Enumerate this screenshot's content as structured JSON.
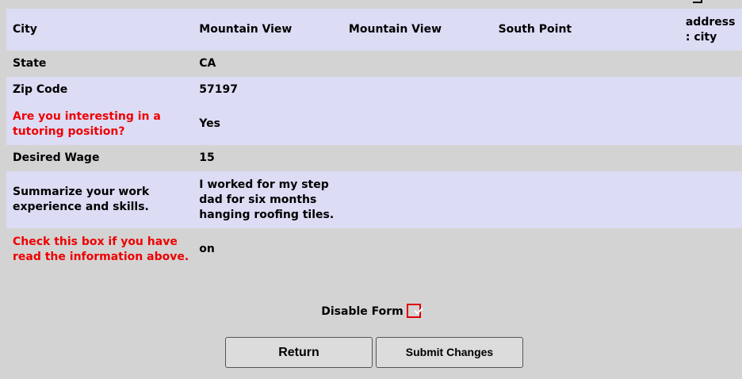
{
  "table": {
    "rows": [
      {
        "label": "City",
        "values": [
          "Mountain View",
          "Mountain View",
          "South Point",
          "address : city"
        ],
        "style": "alt",
        "label_color": "black"
      },
      {
        "label": "State",
        "values": [
          "CA",
          "",
          "",
          ""
        ],
        "style": "plain",
        "label_color": "black"
      },
      {
        "label": "Zip Code",
        "values": [
          "57197",
          "",
          "",
          ""
        ],
        "style": "alt",
        "label_color": "black"
      },
      {
        "label": "Are you interesting in a tutoring position?",
        "values": [
          "Yes",
          "",
          "",
          ""
        ],
        "style": "alt",
        "label_color": "red"
      },
      {
        "label": "Desired Wage",
        "values": [
          "15",
          "",
          "",
          ""
        ],
        "style": "plain",
        "label_color": "black"
      },
      {
        "label": "Summarize your work experience and skills.",
        "values": [
          "I worked for my step dad for six months hanging roofing tiles.",
          "",
          "",
          ""
        ],
        "style": "alt",
        "label_color": "black"
      },
      {
        "label": "Check this box if you have read the information above.",
        "values": [
          "on",
          "",
          "",
          ""
        ],
        "style": "plain",
        "label_color": "red"
      }
    ]
  },
  "disable_form": {
    "label": "Disable Form",
    "checked": true
  },
  "buttons": {
    "return_label": "Return",
    "submit_label": "Submit Changes"
  },
  "colors": {
    "row_alt": "#dcdcf5",
    "background": "#d3d3d3",
    "label_red": "#ee0000",
    "checkbox_blue": "#1a73e8",
    "highlight_red": "#dd0000"
  }
}
